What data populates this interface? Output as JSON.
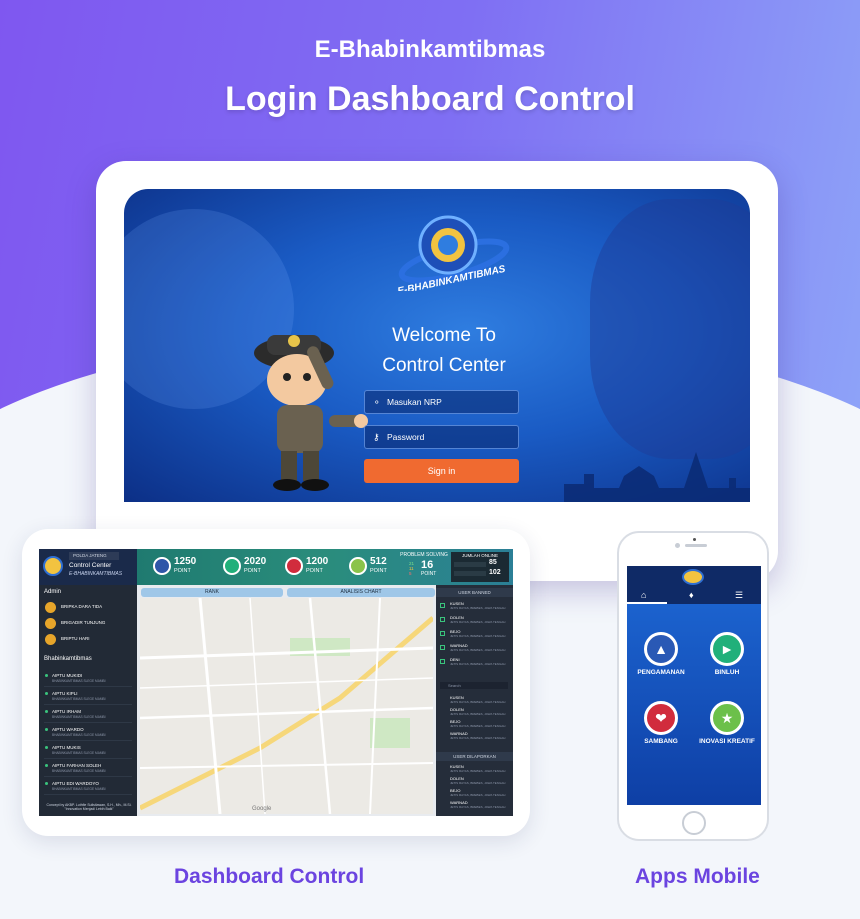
{
  "header": {
    "brand": "E-Bhabinkamtibmas",
    "headline": "Login Dashboard Control"
  },
  "login": {
    "logo_text": "E-BHABINKAMTIBMAS",
    "welcome_line1": "Welcome To",
    "welcome_line2": "Control Center",
    "nrp_placeholder": "Masukan NRP",
    "password_placeholder": "Password",
    "signin_label": "Sign in"
  },
  "dashboard": {
    "region_select": "POLDA JATENG",
    "title": "Control Center",
    "subtitle": "E-BHABINKAMTIBMAS",
    "kpis": [
      {
        "value": "1250",
        "label": "POINT"
      },
      {
        "value": "2020",
        "label": "POINT"
      },
      {
        "value": "1200",
        "label": "POINT"
      },
      {
        "value": "512",
        "label": "POINT"
      }
    ],
    "problem_solving": {
      "label": "PROBLEM SOLVING",
      "small_top": "21",
      "small_mid": "11",
      "small_bot": "5",
      "value": "16",
      "unit": "POINT"
    },
    "online": {
      "label": "JUMLAH ONLINE",
      "row1_value": "85",
      "row2_value": "102"
    },
    "admin_header": "Admin",
    "admins": [
      "BRIPKA DARA TIDA",
      "BRIGADIR TUNJUNG",
      "BRIPTU HARI"
    ],
    "bhabin_header": "Bhabinkamtibmas",
    "bhabins": [
      "AIPTU MUKIDI",
      "AIPTU KIPLI",
      "AIPTU IRHAM",
      "AIPTU WARDO",
      "AIPTU MUKIS",
      "AIPTU FARHAN SOLEH",
      "AIPTU EDI WARDOYO"
    ],
    "bhabin_sub": "BHABINKAMTIBMAS SLEGE MAMBI",
    "tabs": [
      "RANK",
      "ANALISIS CHART"
    ],
    "banned_header": "USER BANNED",
    "banned": [
      "KUSEN",
      "DOLEN",
      "BEJO",
      "WARNAD",
      "DENI"
    ],
    "search_placeholder": "Search",
    "search_list": [
      "KUSEN",
      "DOLEN",
      "BEJO",
      "WARNAD"
    ],
    "reported_header": "USER DILAPORKAN",
    "reported": [
      "KUSEN",
      "DOLEN",
      "BEJO",
      "WARNAD"
    ],
    "item_sub": "JETIS RAYAS, BREBES, JAWA TENGAH",
    "map_google": "Google",
    "footer": "Concept by AKBP. Luthfie Sulistiawan, S.H., Mh., M.Si. \"Innovation Menjadi Lebih Baik\""
  },
  "mobile": {
    "menu": [
      "PENGAMANAN",
      "BINLUH",
      "SAMBANG",
      "INOVASI KREATIF"
    ]
  },
  "captions": {
    "dashboard": "Dashboard Control",
    "mobile": "Apps Mobile"
  },
  "colors": {
    "purple": "#7f57f0",
    "accent_orange": "#f06a30",
    "caption": "#6b44e0"
  }
}
